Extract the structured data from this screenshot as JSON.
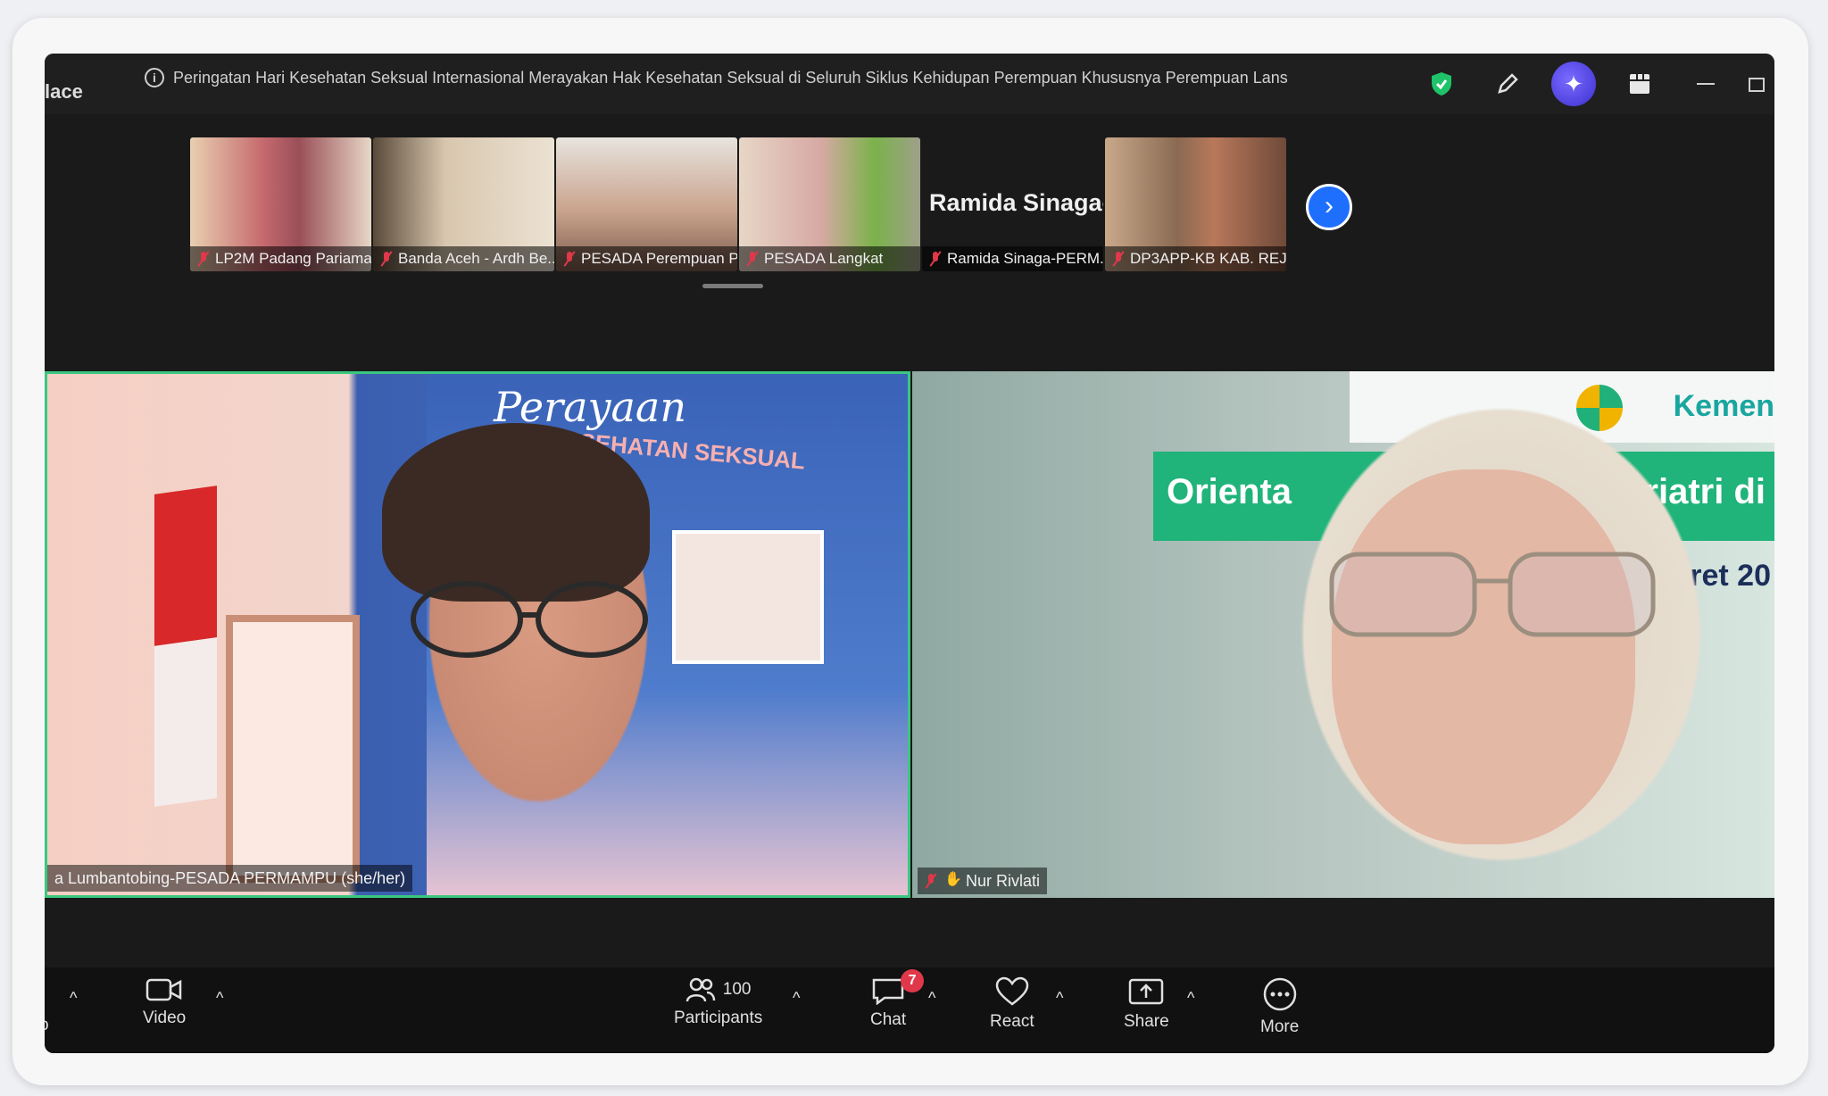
{
  "window": {
    "title_fragment": "lace",
    "meeting_topic": "Peringatan Hari Kesehatan Seksual Internasional Merayakan Hak Kesehatan Seksual di Seluruh Siklus Kehidupan Perempuan Khususnya Perempuan Lans"
  },
  "titlebar_icons": [
    "shield-check-icon",
    "pen-icon",
    "ai-companion-icon",
    "apps-icon",
    "minimize-icon",
    "maximize-icon"
  ],
  "gallery_strip": {
    "thumbnails": [
      {
        "name": "LP2M Padang Pariaman",
        "muted": true
      },
      {
        "name": "Banda Aceh - Ardh Be...",
        "muted": true
      },
      {
        "name": "PESADA Perempuan P...",
        "muted": true
      },
      {
        "name": "PESADA Langkat",
        "muted": true
      },
      {
        "name": "Ramida Sinaga-PERM...",
        "big_name": "Ramida  Sinaga-...",
        "muted": true
      },
      {
        "name": "DP3APP-KB KAB. REJA...",
        "muted": true
      }
    ],
    "next_button": "›"
  },
  "main_tiles": {
    "left": {
      "name": "a Lumbantobing-PESADA PERMAMPU (she/her)",
      "muted": true,
      "poster_title": "Perayaan",
      "poster_subtitle": "KESEHATAN SEKSUAL"
    },
    "right": {
      "name": "Nur Rivlati",
      "muted": true,
      "banner_left": "Orienta",
      "banner_right": "riatri di",
      "date_fragment": "Maret 20",
      "org_fragment": "Kemen"
    }
  },
  "toolbar": {
    "audio_label": "o",
    "video_label": "Video",
    "participants_label": "Participants",
    "participants_count": "100",
    "chat_label": "Chat",
    "chat_badge": "7",
    "react_label": "React",
    "share_label": "Share",
    "more_label": "More",
    "caret": "^"
  },
  "colors": {
    "active_speaker_border": "#3ac780",
    "mute_red": "#e0384a",
    "next_blue": "#1f6fff",
    "toolbar_bg": "#111111"
  }
}
